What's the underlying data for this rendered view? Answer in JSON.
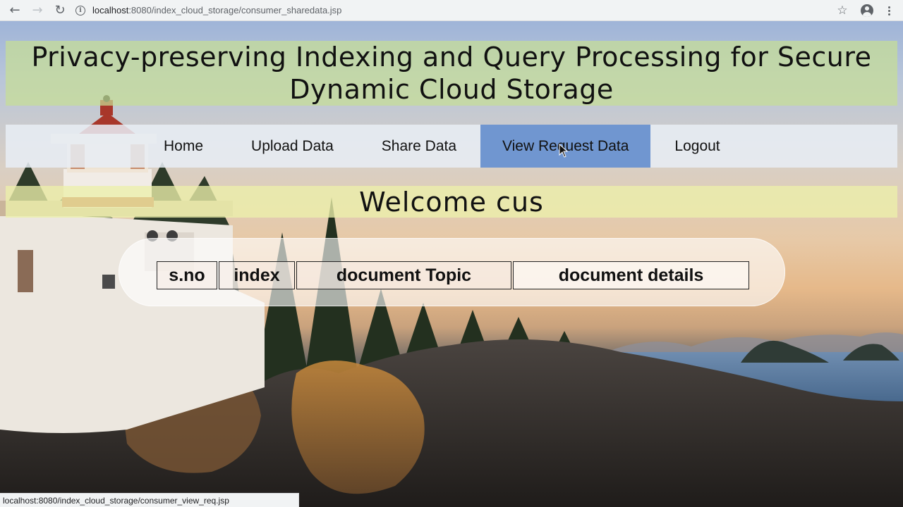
{
  "browser": {
    "url_host": "localhost",
    "url_path": ":8080/index_cloud_storage/consumer_sharedata.jsp",
    "status_url": "localhost:8080/index_cloud_storage/consumer_view_req.jsp",
    "icons": [
      "back-arrow-icon",
      "forward-arrow-icon",
      "reload-icon",
      "info-icon",
      "star-icon",
      "profile-icon",
      "menu-dots-icon"
    ]
  },
  "header": {
    "title": "Privacy-preserving Indexing and Query Processing for Secure Dynamic Cloud Storage"
  },
  "nav": {
    "items": [
      {
        "label": "Home"
      },
      {
        "label": "Upload Data"
      },
      {
        "label": "Share Data"
      },
      {
        "label": "View Request Data",
        "active": true
      },
      {
        "label": "Logout"
      }
    ]
  },
  "welcome": {
    "text": "Welcome cus"
  },
  "table": {
    "columns": [
      "s.no",
      "index",
      "document Topic",
      "document details"
    ]
  },
  "colors": {
    "title_band": "#c6de96",
    "welcome_band": "#ecf0aa",
    "nav_active": "#7096d0"
  }
}
